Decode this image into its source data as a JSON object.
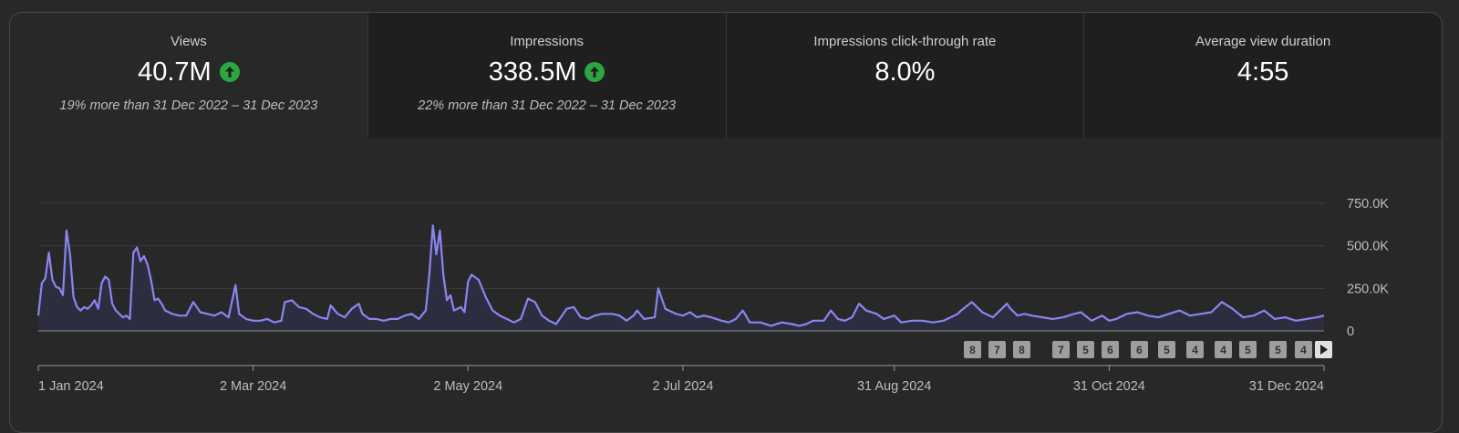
{
  "metrics": [
    {
      "label": "Views",
      "value": "40.7M",
      "trend": "up",
      "comparison": "19% more than 31 Dec 2022 – 31 Dec 2023",
      "selected": true
    },
    {
      "label": "Impressions",
      "value": "338.5M",
      "trend": "up",
      "comparison": "22% more than 31 Dec 2022 – 31 Dec 2023",
      "selected": false
    },
    {
      "label": "Impressions click-through rate",
      "value": "8.0%",
      "trend": "",
      "comparison": "",
      "selected": false
    },
    {
      "label": "Average view duration",
      "value": "4:55",
      "trend": "",
      "comparison": "",
      "selected": false
    }
  ],
  "colors": {
    "line": "#8b85f0",
    "fill": "#2e2d42",
    "trend_up": "#2ba640",
    "grid": "#3d3d3d",
    "axis": "#9a9a9a"
  },
  "chart_data": {
    "type": "area",
    "y_ticks": [
      {
        "value": 750000,
        "label": "750.0K"
      },
      {
        "value": 500000,
        "label": "500.0K"
      },
      {
        "value": 250000,
        "label": "250.0K"
      },
      {
        "value": 0,
        "label": "0"
      }
    ],
    "ylim": [
      0,
      750000
    ],
    "xlim": [
      "2024-01-01",
      "2024-12-31"
    ],
    "x_ticks": [
      {
        "date": "2024-01-01",
        "label": "1 Jan 2024"
      },
      {
        "date": "2024-03-02",
        "label": "2 Mar 2024"
      },
      {
        "date": "2024-05-02",
        "label": "2 May 2024"
      },
      {
        "date": "2024-07-02",
        "label": "2 Jul 2024"
      },
      {
        "date": "2024-08-31",
        "label": "31 Aug 2024"
      },
      {
        "date": "2024-10-31",
        "label": "31 Oct 2024"
      },
      {
        "date": "2024-12-31",
        "label": "31 Dec 2024"
      }
    ],
    "series": [
      {
        "points": [
          [
            "2024-01-01",
            90000
          ],
          [
            "2024-01-02",
            280000
          ],
          [
            "2024-01-03",
            310000
          ],
          [
            "2024-01-04",
            460000
          ],
          [
            "2024-01-05",
            300000
          ],
          [
            "2024-01-06",
            260000
          ],
          [
            "2024-01-07",
            250000
          ],
          [
            "2024-01-08",
            210000
          ],
          [
            "2024-01-09",
            590000
          ],
          [
            "2024-01-10",
            450000
          ],
          [
            "2024-01-11",
            200000
          ],
          [
            "2024-01-12",
            140000
          ],
          [
            "2024-01-13",
            120000
          ],
          [
            "2024-01-14",
            140000
          ],
          [
            "2024-01-15",
            130000
          ],
          [
            "2024-01-16",
            150000
          ],
          [
            "2024-01-17",
            180000
          ],
          [
            "2024-01-18",
            130000
          ],
          [
            "2024-01-19",
            280000
          ],
          [
            "2024-01-20",
            320000
          ],
          [
            "2024-01-21",
            300000
          ],
          [
            "2024-01-22",
            160000
          ],
          [
            "2024-01-23",
            120000
          ],
          [
            "2024-01-24",
            100000
          ],
          [
            "2024-01-25",
            80000
          ],
          [
            "2024-01-26",
            90000
          ],
          [
            "2024-01-27",
            70000
          ],
          [
            "2024-01-28",
            460000
          ],
          [
            "2024-01-29",
            490000
          ],
          [
            "2024-01-30",
            410000
          ],
          [
            "2024-01-31",
            440000
          ],
          [
            "2024-02-01",
            390000
          ],
          [
            "2024-02-02",
            300000
          ],
          [
            "2024-02-03",
            180000
          ],
          [
            "2024-02-04",
            190000
          ],
          [
            "2024-02-05",
            160000
          ],
          [
            "2024-02-06",
            120000
          ],
          [
            "2024-02-08",
            100000
          ],
          [
            "2024-02-10",
            90000
          ],
          [
            "2024-02-12",
            90000
          ],
          [
            "2024-02-14",
            170000
          ],
          [
            "2024-02-16",
            110000
          ],
          [
            "2024-02-18",
            100000
          ],
          [
            "2024-02-20",
            90000
          ],
          [
            "2024-02-22",
            110000
          ],
          [
            "2024-02-24",
            80000
          ],
          [
            "2024-02-26",
            270000
          ],
          [
            "2024-02-27",
            100000
          ],
          [
            "2024-02-29",
            70000
          ],
          [
            "2024-03-02",
            60000
          ],
          [
            "2024-03-04",
            60000
          ],
          [
            "2024-03-06",
            70000
          ],
          [
            "2024-03-08",
            50000
          ],
          [
            "2024-03-10",
            60000
          ],
          [
            "2024-03-11",
            170000
          ],
          [
            "2024-03-13",
            180000
          ],
          [
            "2024-03-15",
            140000
          ],
          [
            "2024-03-17",
            130000
          ],
          [
            "2024-03-19",
            100000
          ],
          [
            "2024-03-21",
            80000
          ],
          [
            "2024-03-23",
            70000
          ],
          [
            "2024-03-24",
            150000
          ],
          [
            "2024-03-26",
            100000
          ],
          [
            "2024-03-28",
            80000
          ],
          [
            "2024-03-30",
            130000
          ],
          [
            "2024-04-01",
            160000
          ],
          [
            "2024-04-02",
            100000
          ],
          [
            "2024-04-04",
            70000
          ],
          [
            "2024-04-06",
            70000
          ],
          [
            "2024-04-08",
            60000
          ],
          [
            "2024-04-10",
            70000
          ],
          [
            "2024-04-12",
            70000
          ],
          [
            "2024-04-14",
            90000
          ],
          [
            "2024-04-16",
            100000
          ],
          [
            "2024-04-18",
            70000
          ],
          [
            "2024-04-20",
            120000
          ],
          [
            "2024-04-21",
            330000
          ],
          [
            "2024-04-22",
            620000
          ],
          [
            "2024-04-23",
            450000
          ],
          [
            "2024-04-24",
            590000
          ],
          [
            "2024-04-25",
            330000
          ],
          [
            "2024-04-26",
            180000
          ],
          [
            "2024-04-27",
            210000
          ],
          [
            "2024-04-28",
            120000
          ],
          [
            "2024-04-30",
            140000
          ],
          [
            "2024-05-01",
            110000
          ],
          [
            "2024-05-02",
            290000
          ],
          [
            "2024-05-03",
            330000
          ],
          [
            "2024-05-05",
            300000
          ],
          [
            "2024-05-07",
            200000
          ],
          [
            "2024-05-09",
            120000
          ],
          [
            "2024-05-11",
            90000
          ],
          [
            "2024-05-13",
            70000
          ],
          [
            "2024-05-15",
            50000
          ],
          [
            "2024-05-17",
            70000
          ],
          [
            "2024-05-19",
            190000
          ],
          [
            "2024-05-21",
            170000
          ],
          [
            "2024-05-23",
            90000
          ],
          [
            "2024-05-25",
            60000
          ],
          [
            "2024-05-27",
            40000
          ],
          [
            "2024-05-30",
            130000
          ],
          [
            "2024-06-01",
            140000
          ],
          [
            "2024-06-03",
            80000
          ],
          [
            "2024-06-05",
            70000
          ],
          [
            "2024-06-07",
            90000
          ],
          [
            "2024-06-09",
            100000
          ],
          [
            "2024-06-12",
            100000
          ],
          [
            "2024-06-14",
            90000
          ],
          [
            "2024-06-16",
            60000
          ],
          [
            "2024-06-18",
            90000
          ],
          [
            "2024-06-19",
            120000
          ],
          [
            "2024-06-21",
            70000
          ],
          [
            "2024-06-24",
            80000
          ],
          [
            "2024-06-25",
            250000
          ],
          [
            "2024-06-27",
            130000
          ],
          [
            "2024-06-30",
            100000
          ],
          [
            "2024-07-02",
            90000
          ],
          [
            "2024-07-04",
            110000
          ],
          [
            "2024-07-06",
            80000
          ],
          [
            "2024-07-08",
            90000
          ],
          [
            "2024-07-10",
            80000
          ],
          [
            "2024-07-13",
            60000
          ],
          [
            "2024-07-15",
            50000
          ],
          [
            "2024-07-17",
            70000
          ],
          [
            "2024-07-19",
            120000
          ],
          [
            "2024-07-21",
            50000
          ],
          [
            "2024-07-24",
            50000
          ],
          [
            "2024-07-27",
            30000
          ],
          [
            "2024-07-30",
            50000
          ],
          [
            "2024-08-02",
            40000
          ],
          [
            "2024-08-04",
            30000
          ],
          [
            "2024-08-06",
            40000
          ],
          [
            "2024-08-08",
            60000
          ],
          [
            "2024-08-11",
            60000
          ],
          [
            "2024-08-13",
            120000
          ],
          [
            "2024-08-15",
            70000
          ],
          [
            "2024-08-17",
            60000
          ],
          [
            "2024-08-19",
            80000
          ],
          [
            "2024-08-21",
            160000
          ],
          [
            "2024-08-23",
            120000
          ],
          [
            "2024-08-26",
            100000
          ],
          [
            "2024-08-28",
            70000
          ],
          [
            "2024-08-31",
            90000
          ],
          [
            "2024-09-02",
            50000
          ],
          [
            "2024-09-05",
            60000
          ],
          [
            "2024-09-08",
            60000
          ],
          [
            "2024-09-11",
            50000
          ],
          [
            "2024-09-14",
            60000
          ],
          [
            "2024-09-17",
            90000
          ],
          [
            "2024-09-18",
            100000
          ],
          [
            "2024-09-19",
            120000
          ],
          [
            "2024-09-22",
            170000
          ],
          [
            "2024-09-25",
            110000
          ],
          [
            "2024-09-28",
            80000
          ],
          [
            "2024-10-02",
            160000
          ],
          [
            "2024-10-03",
            130000
          ],
          [
            "2024-10-05",
            90000
          ],
          [
            "2024-10-07",
            100000
          ],
          [
            "2024-10-09",
            90000
          ],
          [
            "2024-10-12",
            80000
          ],
          [
            "2024-10-15",
            70000
          ],
          [
            "2024-10-18",
            80000
          ],
          [
            "2024-10-21",
            100000
          ],
          [
            "2024-10-23",
            110000
          ],
          [
            "2024-10-26",
            60000
          ],
          [
            "2024-10-29",
            90000
          ],
          [
            "2024-10-31",
            60000
          ],
          [
            "2024-11-02",
            70000
          ],
          [
            "2024-11-05",
            100000
          ],
          [
            "2024-11-08",
            110000
          ],
          [
            "2024-11-11",
            90000
          ],
          [
            "2024-11-14",
            80000
          ],
          [
            "2024-11-17",
            100000
          ],
          [
            "2024-11-20",
            120000
          ],
          [
            "2024-11-23",
            90000
          ],
          [
            "2024-11-26",
            100000
          ],
          [
            "2024-11-29",
            110000
          ],
          [
            "2024-12-02",
            170000
          ],
          [
            "2024-12-05",
            130000
          ],
          [
            "2024-12-08",
            80000
          ],
          [
            "2024-12-11",
            90000
          ],
          [
            "2024-12-14",
            120000
          ],
          [
            "2024-12-17",
            70000
          ],
          [
            "2024-12-20",
            80000
          ],
          [
            "2024-12-23",
            60000
          ],
          [
            "2024-12-26",
            70000
          ],
          [
            "2024-12-29",
            80000
          ],
          [
            "2024-12-31",
            90000
          ]
        ]
      }
    ],
    "grid": true
  },
  "badges": [
    "8",
    "7",
    "8",
    "7",
    "5",
    "6",
    "6",
    "5",
    "4",
    "4",
    "5",
    "5",
    "4"
  ]
}
